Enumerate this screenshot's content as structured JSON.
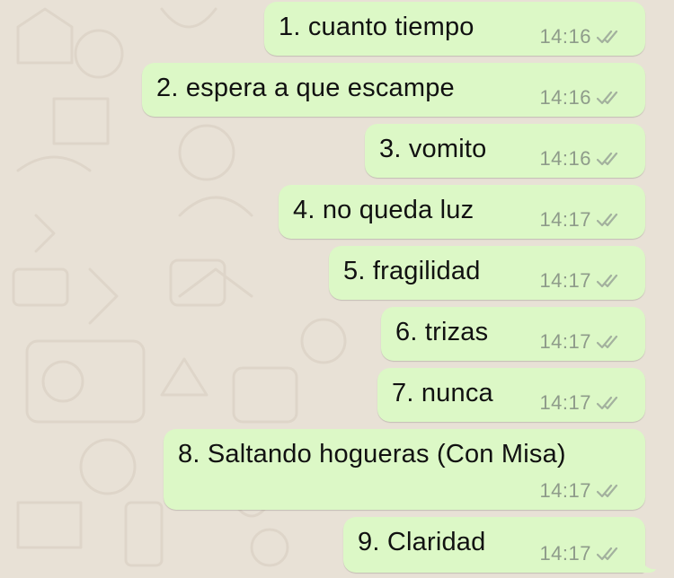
{
  "chat": {
    "messages": [
      {
        "text": "1. cuanto tiempo",
        "time": "14:16",
        "status": "read"
      },
      {
        "text": "2. espera a que escampe",
        "time": "14:16",
        "status": "read"
      },
      {
        "text": "3. vomito",
        "time": "14:16",
        "status": "read"
      },
      {
        "text": "4. no queda luz",
        "time": "14:17",
        "status": "read"
      },
      {
        "text": "5. fragilidad",
        "time": "14:17",
        "status": "read"
      },
      {
        "text": "6. trizas",
        "time": "14:17",
        "status": "read"
      },
      {
        "text": "7. nunca",
        "time": "14:17",
        "status": "read"
      },
      {
        "text": "8. Saltando hogueras (Con Misa)",
        "time": "14:17",
        "status": "read"
      },
      {
        "text": "9. Claridad",
        "time": "14:17",
        "status": "read"
      }
    ]
  },
  "colors": {
    "background": "#e8e1d6",
    "bubble": "#dcf8c6",
    "time": "#8e9b8a",
    "ticks": "#a3b19e"
  }
}
